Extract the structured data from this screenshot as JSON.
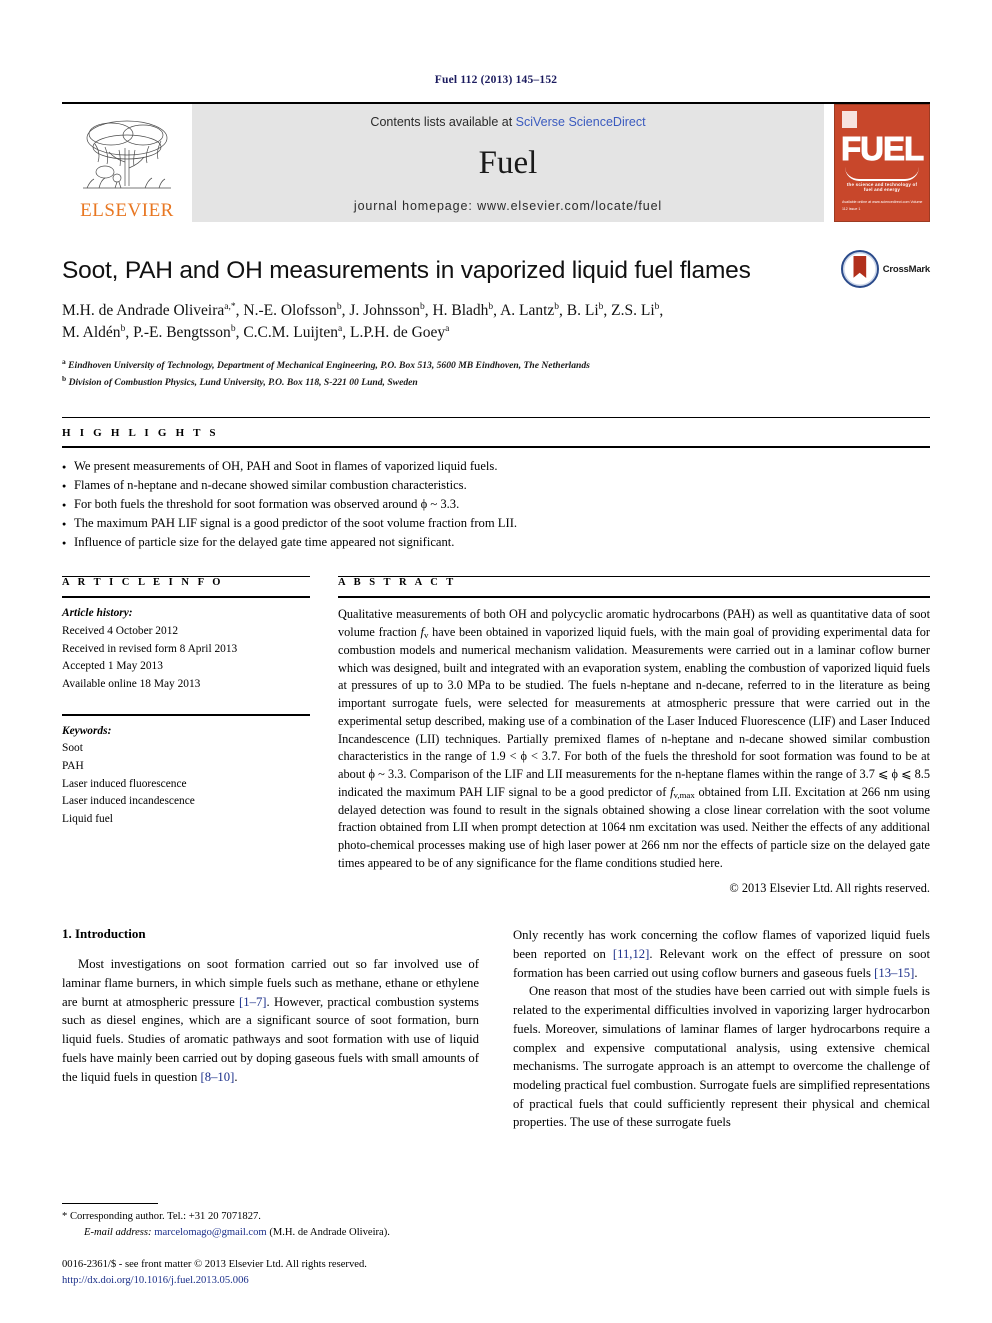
{
  "running_head": "Fuel 112 (2013) 145–152",
  "masthead": {
    "contents_prefix": "Contents lists available at ",
    "sciencedirect_link": "SciVerse ScienceDirect",
    "journal_name": "Fuel",
    "homepage": "journal homepage: www.elsevier.com/locate/fuel",
    "publisher_name": "ELSEVIER",
    "cover": {
      "title": "FUEL",
      "subtitle": "the science and technology of fuel and energy",
      "footer": "Available online at www.sciencedirect.com\nVolume 112 Issue 1"
    }
  },
  "article": {
    "title": "Soot, PAH and OH measurements in vaporized liquid fuel flames",
    "crossmark_label": "CrossMark",
    "authors_line1": "M.H. de Andrade Oliveira a,*, N.-E. Olofsson b, J. Johnsson b, H. Bladh b, A. Lantz b, B. Li b, Z.S. Li b,",
    "authors_line2": "M. Aldén b, P.-E. Bengtsson b, C.C.M. Luijten a, L.P.H. de Goey a",
    "affiliation_a": "Eindhoven University of Technology, Department of Mechanical Engineering, P.O. Box 513, 5600 MB Eindhoven, The Netherlands",
    "affiliation_b": "Division of Combustion Physics, Lund University, P.O. Box 118, S-221 00 Lund, Sweden"
  },
  "highlights": {
    "heading": "H I G H L I G H T S",
    "items": [
      "We present measurements of OH, PAH and Soot in flames of vaporized liquid fuels.",
      "Flames of n-heptane and n-decane showed similar combustion characteristics.",
      "For both fuels the threshold for soot formation was observed around ϕ ~ 3.3.",
      "The maximum PAH LIF signal is a good predictor of the soot volume fraction from LII.",
      "Influence of particle size for the delayed gate time appeared not significant."
    ]
  },
  "article_info": {
    "heading": "A R T I C L E    I N F O",
    "history_label": "Article history:",
    "history": [
      "Received 4 October 2012",
      "Received in revised form 8 April 2013",
      "Accepted 1 May 2013",
      "Available online 18 May 2013"
    ],
    "keywords_label": "Keywords:",
    "keywords": [
      "Soot",
      "PAH",
      "Laser induced fluorescence",
      "Laser induced incandescence",
      "Liquid fuel"
    ]
  },
  "abstract": {
    "heading": "A B S T R A C T",
    "part1": "Qualitative measurements of both OH and polycyclic aromatic hydrocarbons (PAH) as well as quantitative data of soot volume fraction ",
    "fv_symbol": "f",
    "fv_sub": "v",
    "part2": " have been obtained in vaporized liquid fuels, with the main goal of providing experimental data for combustion models and numerical mechanism validation. Measurements were carried out in a laminar coflow burner which was designed, built and integrated with an evaporation system, enabling the combustion of vaporized liquid fuels at pressures of up to 3.0 MPa to be studied. The fuels n-heptane and n-decane, referred to in the literature as being important surrogate fuels, were selected for measurements at atmospheric pressure that were carried out in the experimental setup described, making use of a combination of the Laser Induced Fluorescence (LIF) and Laser Induced Incandescence (LII) techniques. Partially premixed flames of n-heptane and n-decane showed similar combustion characteristics in the range of 1.9 < ϕ < 3.7. For both of the fuels the threshold for soot formation was found to be at about ϕ ~ 3.3. Comparison of the LIF and LII measurements for the n-heptane flames within the range of 3.7 ⩽ ϕ ⩽ 8.5 indicated the maximum PAH LIF signal to be a good predictor of ",
    "fvmax_symbol": "f",
    "fvmax_sub": "v,max",
    "part3": " obtained from LII. Excitation at 266 nm using delayed detection was found to result in the signals obtained showing a close linear correlation with the soot volume fraction obtained from LII when prompt detection at 1064 nm excitation was used. Neither the effects of any additional photo-chemical processes making use of high laser power at 266 nm nor the effects of particle size on the delayed gate times appeared to be of any significance for the flame conditions studied here.",
    "copyright": "© 2013 Elsevier Ltd. All rights reserved."
  },
  "introduction": {
    "section_number_title": "1. Introduction",
    "left_para1_a": "Most investigations on soot formation carried out so far involved use of laminar flame burners, in which simple fuels such as methane, ethane or ethylene are burnt at atmospheric pressure ",
    "left_ref1": "[1–7]",
    "left_para1_b": ". However, practical combustion systems such as diesel engines, which are a significant source of soot formation, burn liquid fuels. Studies of aromatic pathways and soot formation with use of liquid fuels have mainly been carried out by doping gaseous fuels with small amounts of the liquid fuels in question ",
    "left_ref2": "[8–10]",
    "left_para1_c": ".",
    "right_para1_a": "Only recently has work concerning the coflow flames of vaporized liquid fuels been reported on ",
    "right_ref1": "[11,12]",
    "right_para1_b": ". Relevant work on the effect of pressure on soot formation has been carried out using coflow burners and gaseous fuels ",
    "right_ref2": "[13–15]",
    "right_para1_c": ".",
    "right_para2": "One reason that most of the studies have been carried out with simple fuels is related to the experimental difficulties involved in vaporizing larger hydrocarbon fuels. Moreover, simulations of laminar flames of larger hydrocarbons require a complex and expensive computational analysis, using extensive chemical mechanisms. The surrogate approach is an attempt to overcome the challenge of modeling practical fuel combustion. Surrogate fuels are simplified representations of practical fuels that could sufficiently represent their physical and chemical properties. The use of these surrogate fuels"
  },
  "footnotes": {
    "corresponding": "* Corresponding author. Tel.: +31 20 7071827.",
    "email_label": "E-mail address:",
    "email": "marcelomago@gmail.com",
    "email_owner": "(M.H. de Andrade Oliveira).",
    "issn_line": "0016-2361/$ - see front matter © 2013 Elsevier Ltd. All rights reserved.",
    "doi": "http://dx.doi.org/10.1016/j.fuel.2013.05.006"
  },
  "colors": {
    "link_blue": "#1b2f8a",
    "sciencedirect_blue": "#3b5bbf",
    "elsevier_orange": "#E87722",
    "cover_red": "#c8472b"
  }
}
